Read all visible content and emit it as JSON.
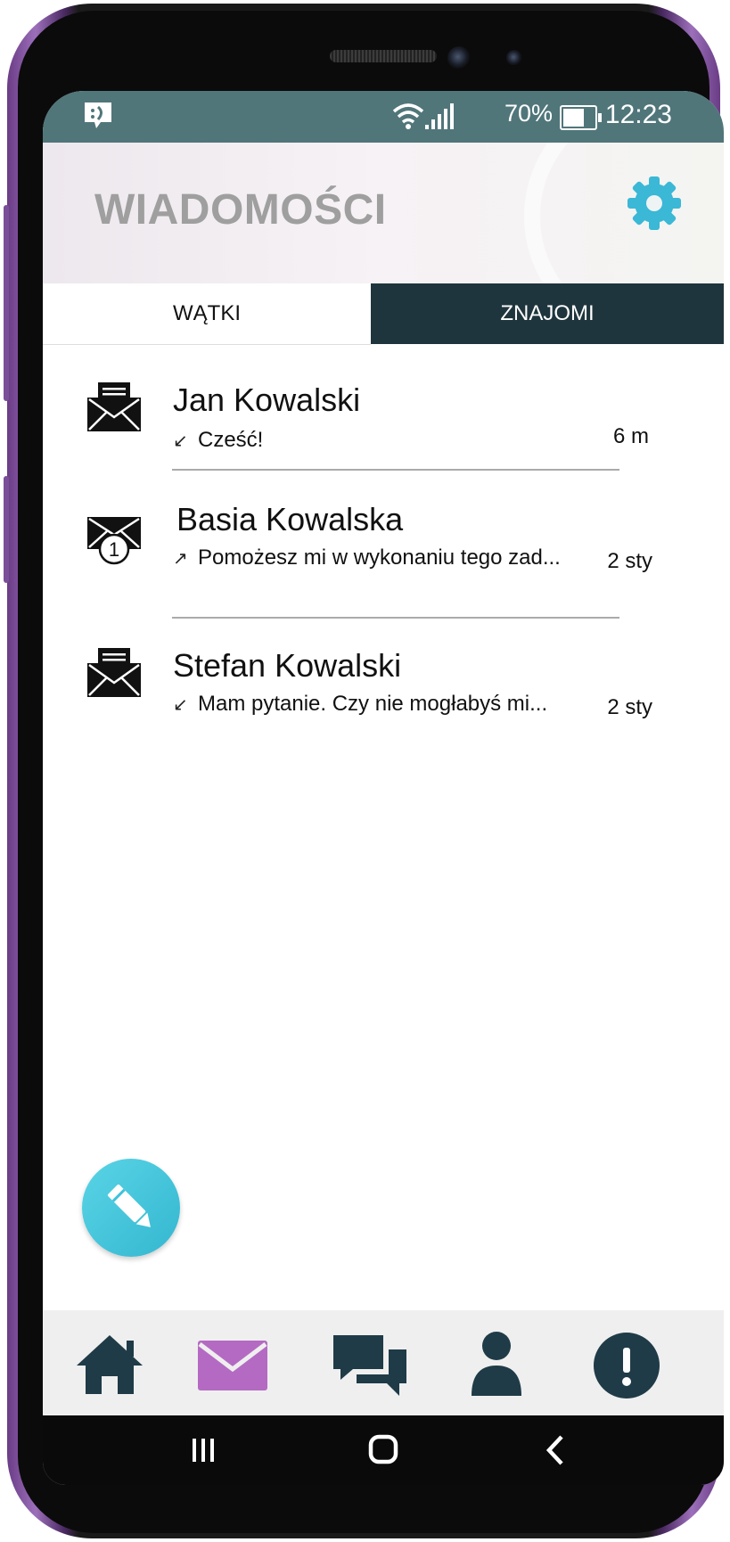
{
  "status_bar": {
    "battery_percent": "70%",
    "battery_level": 0.7,
    "time": "12:23",
    "icons": [
      "notification-message-icon",
      "wifi-icon",
      "signal-icon",
      "battery-icon"
    ]
  },
  "header": {
    "title": "WIADOMOŚCI",
    "settings_icon": "gear-icon",
    "accent_color": "#3ab8d6"
  },
  "tabs": [
    {
      "label": "WĄTKI",
      "active": true
    },
    {
      "label": "ZNAJOMI",
      "active": false
    }
  ],
  "threads": [
    {
      "name": "Jan Kowalski",
      "direction": "incoming",
      "arrow": "↙",
      "preview": "Cześć!",
      "time": "6 m",
      "icon": "open-envelope-icon"
    },
    {
      "name": "Basia Kowalska",
      "direction": "outgoing",
      "arrow": "↗",
      "preview": "Pomożesz mi w wykonaniu tego zad...",
      "time": "2 sty",
      "icon": "envelope-unread-icon",
      "unread_count": "1"
    },
    {
      "name": "Stefan Kowalski",
      "direction": "incoming",
      "arrow": "↙",
      "preview": "Mam pytanie. Czy nie mogłabyś mi...",
      "time": "2 sty",
      "icon": "open-envelope-icon"
    }
  ],
  "fab": {
    "icon": "pencil-icon"
  },
  "bottom_nav": [
    {
      "icon": "home-icon",
      "active": false
    },
    {
      "icon": "mail-icon",
      "active": true
    },
    {
      "icon": "chat-icon",
      "active": false
    },
    {
      "icon": "person-icon",
      "active": false
    },
    {
      "icon": "alert-icon",
      "active": false
    }
  ],
  "colors": {
    "status_bar": "#50767a",
    "tab_dark": "#1f353d",
    "nav_icon": "#1f3b47",
    "nav_active": "#b46ac2",
    "fab": "#3ec3da"
  }
}
